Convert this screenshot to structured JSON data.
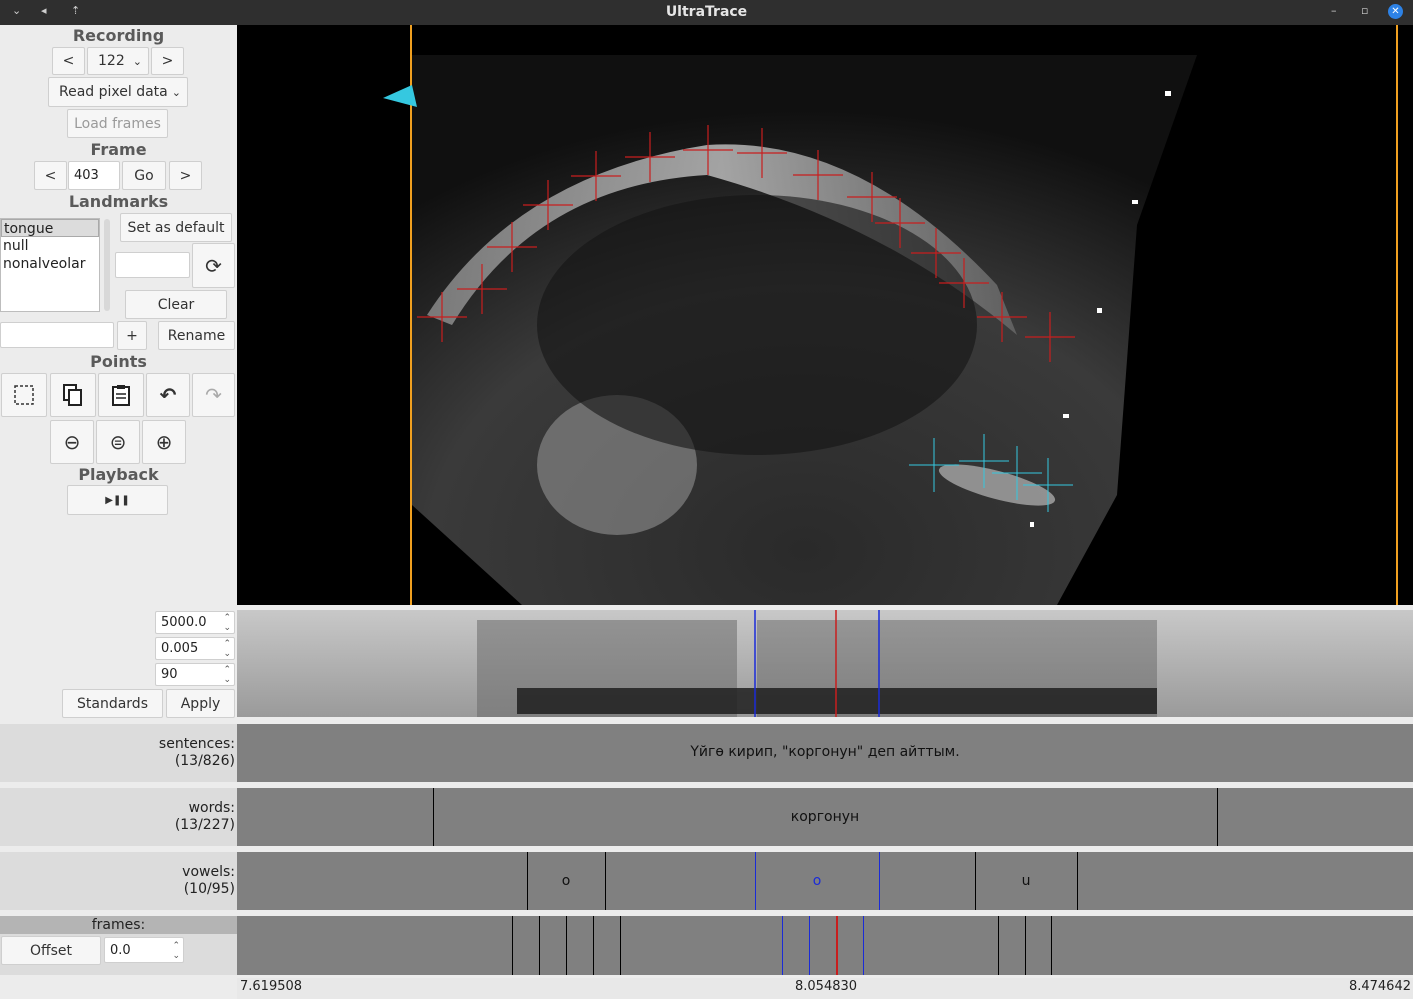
{
  "window": {
    "title": "UltraTrace"
  },
  "recording": {
    "header": "Recording",
    "prev": "<",
    "next": ">",
    "value": "122",
    "mode": "Read pixel data",
    "load": "Load frames"
  },
  "frame": {
    "header": "Frame",
    "prev": "<",
    "value": "403",
    "go": "Go",
    "next": ">"
  },
  "landmarks": {
    "header": "Landmarks",
    "items": [
      "tongue",
      "null",
      "nonalveolar"
    ],
    "set_default": "Set as default",
    "clear": "Clear",
    "add": "+",
    "rename": "Rename"
  },
  "points": {
    "header": "Points"
  },
  "playback": {
    "header": "Playback"
  },
  "spectrogram": {
    "freq": "5000.0",
    "window": "0.005",
    "dyn": "90",
    "standards": "Standards",
    "apply": "Apply"
  },
  "tiers": {
    "sentences": {
      "label": "sentences:",
      "count": "(13/826)",
      "text": "Үйгө кирип, \"коргонун\" деп айттым."
    },
    "words": {
      "label": "words:",
      "count": "(13/227)",
      "text": "коргонун"
    },
    "vowels": {
      "label": "vowels:",
      "count": "(10/95)",
      "items": [
        "o",
        "o",
        "u"
      ]
    },
    "frames": {
      "label": "frames:",
      "offset_label": "Offset",
      "offset_value": "0.0"
    }
  },
  "timeline": {
    "start": "7.619508",
    "mid": "8.054830",
    "end": "8.474642"
  },
  "colors": {
    "accent_red": "#c81e1e",
    "accent_blue": "#1a2bd8",
    "trace_cyan": "#35c8e0",
    "orange": "#f0a020"
  },
  "icons": [
    "chevron-down-icon",
    "refresh-icon",
    "select-icon",
    "copy-icon",
    "paste-icon",
    "undo-icon",
    "redo-icon",
    "zoom-out-icon",
    "zoom-reset-icon",
    "zoom-in-icon",
    "play-pause-icon"
  ]
}
